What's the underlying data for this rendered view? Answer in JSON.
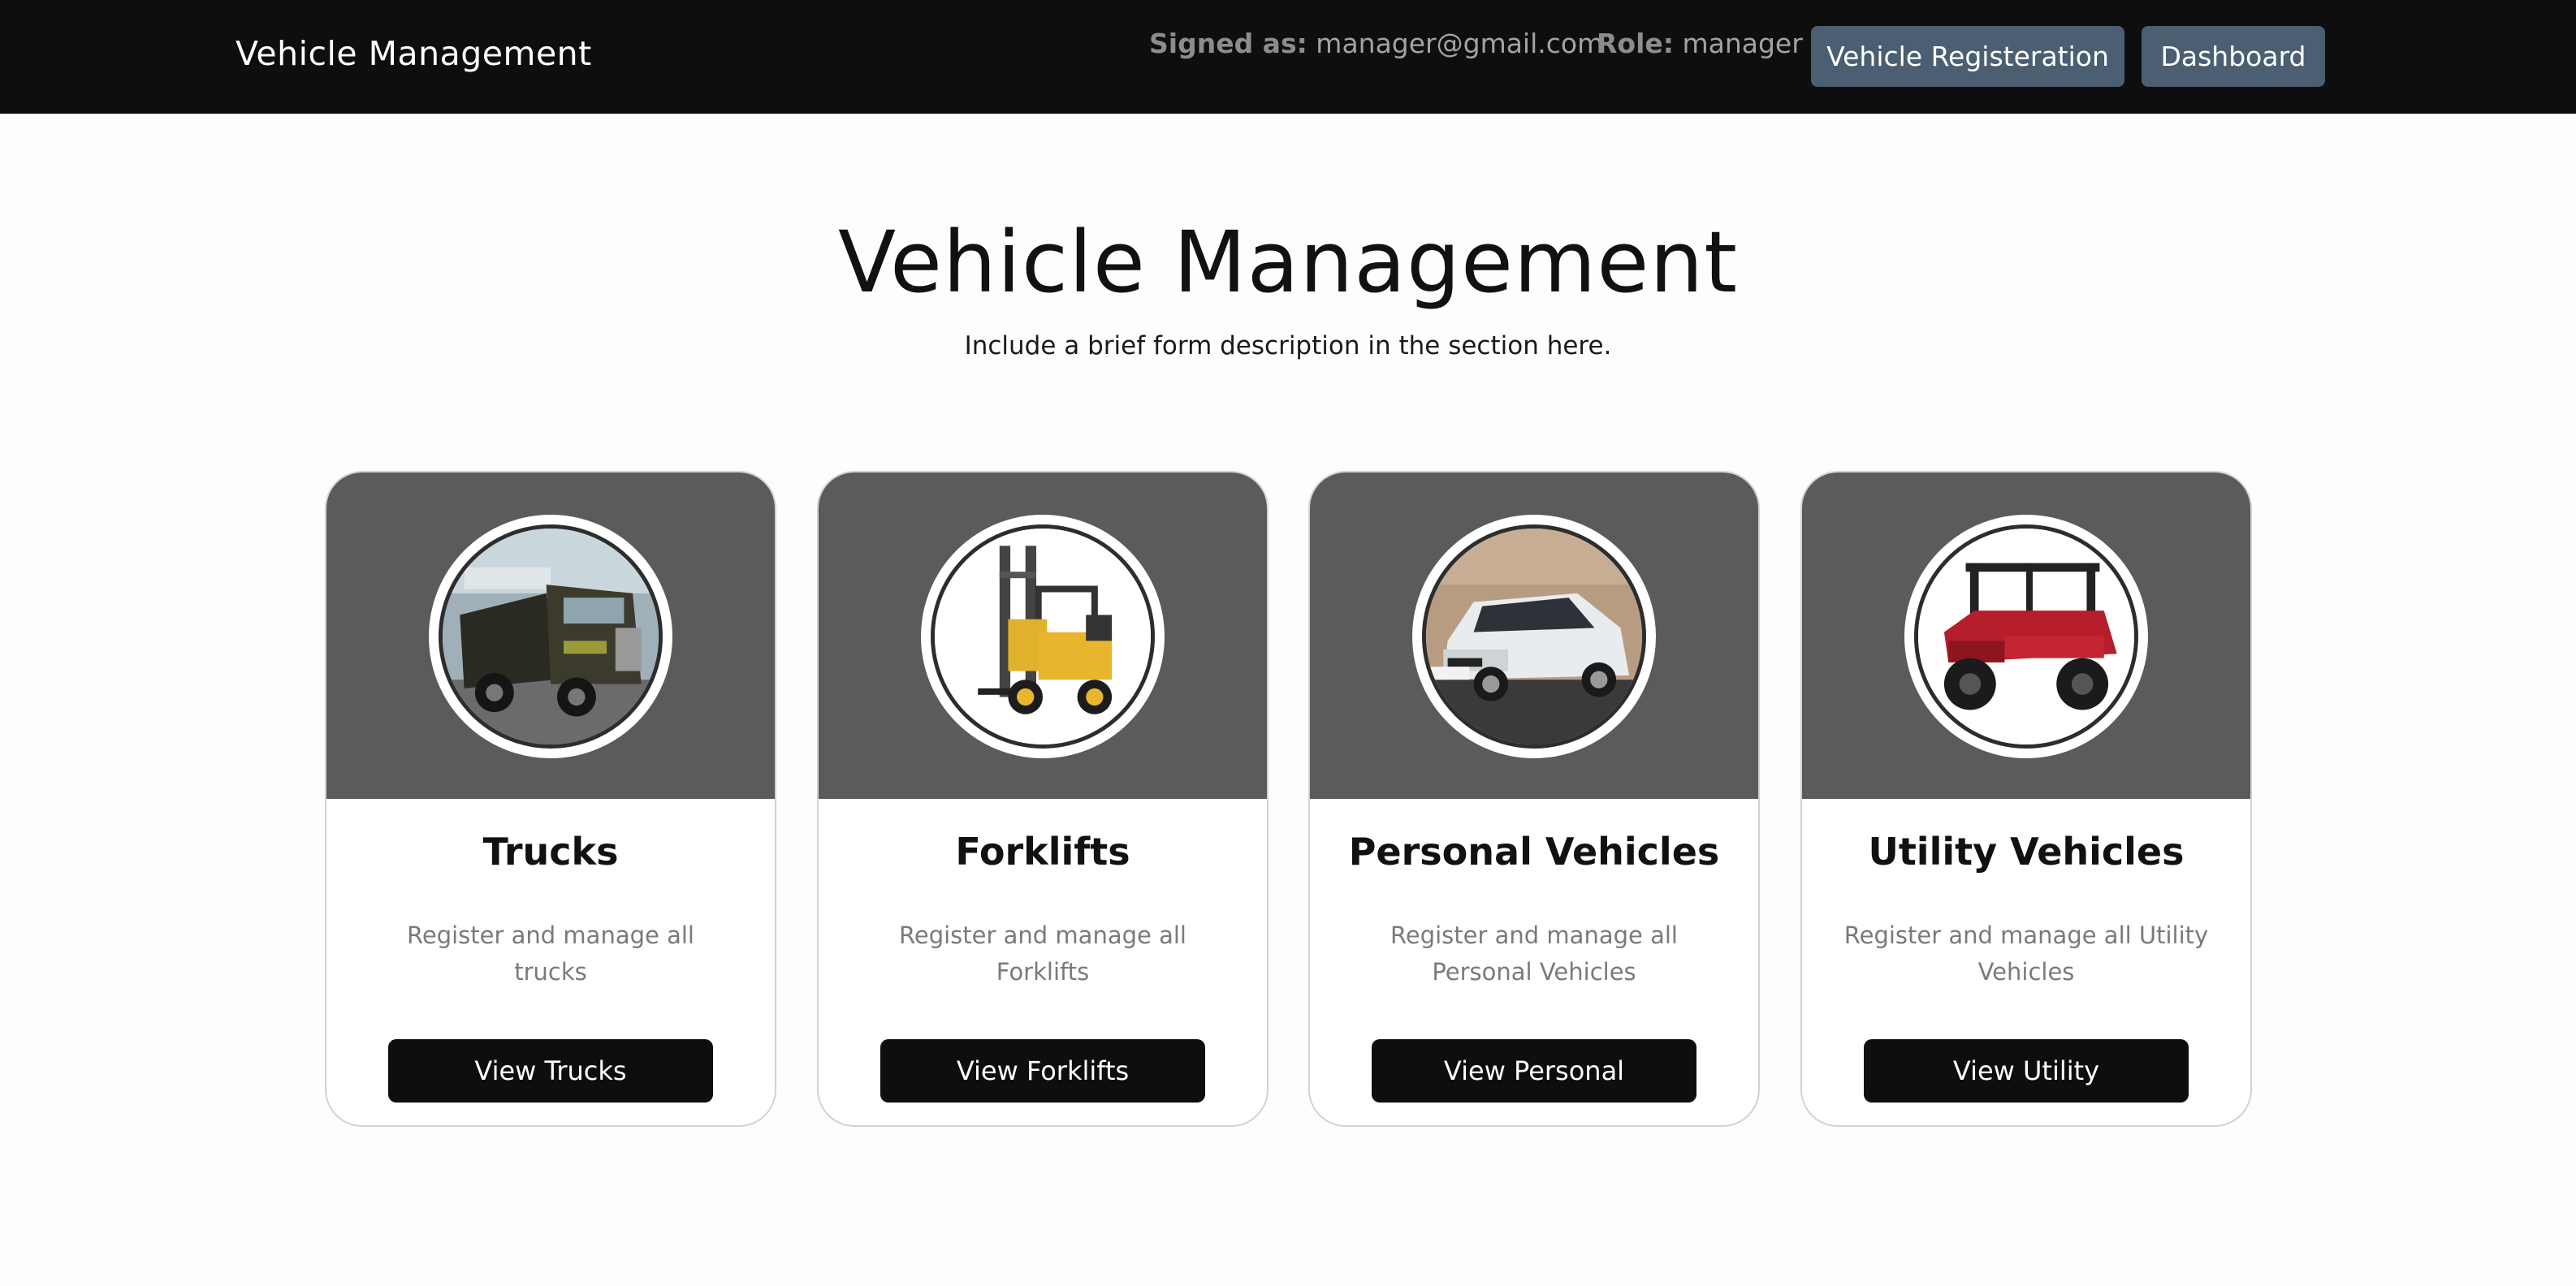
{
  "navbar": {
    "brand": "Vehicle Management",
    "signed_label": "Signed as:",
    "signed_value": "manager@gmail.com",
    "role_label": "Role:",
    "role_value": "manager",
    "register_button": "Vehicle Registeration",
    "dashboard_button": "Dashboard"
  },
  "hero": {
    "title": "Vehicle Management",
    "subtitle": "Include a brief form description in the section here."
  },
  "cards": [
    {
      "title": "Trucks",
      "description": "Register and manage all trucks",
      "button": "View Trucks",
      "image_icon": "truck-image"
    },
    {
      "title": "Forklifts",
      "description": "Register and manage all Forklifts",
      "button": "View Forklifts",
      "image_icon": "forklift-image"
    },
    {
      "title": "Personal Vehicles",
      "description": "Register and manage all Personal Vehicles",
      "button": "View Personal",
      "image_icon": "car-image"
    },
    {
      "title": "Utility Vehicles",
      "description": "Register and manage all Utility Vehicles",
      "button": "View Utility",
      "image_icon": "utility-vehicle-image"
    }
  ],
  "colors": {
    "navbar_bg": "#0e0e0e",
    "nav_button_bg": "#4b5e72",
    "card_header_bg": "#5b5b5b",
    "card_button_bg": "#0e0e0e"
  }
}
